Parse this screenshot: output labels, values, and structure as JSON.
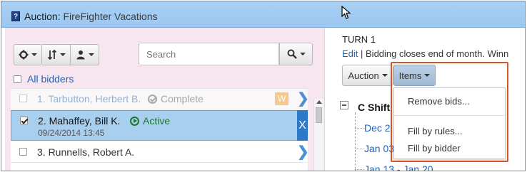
{
  "window": {
    "icon": "help-icon",
    "icon_glyph": "?",
    "title_prefix": "Auction:",
    "title_name": "FireFighter Vacations"
  },
  "toolbar": {
    "settings_icon": "gear-icon",
    "sort_icon": "sort-icon",
    "user_icon": "user-icon",
    "search_placeholder": "Search",
    "search_icon": "search-icon"
  },
  "bidders": {
    "all_label": "All bidders",
    "rows": [
      {
        "name": "1. Tarbutton, Herbert B.",
        "status": "Complete",
        "badge": "W",
        "checked": false
      },
      {
        "name": "2. Mahaffey, Bill K.",
        "status": "Active",
        "date": "09/24/2014 13:45",
        "checked": true,
        "remove_label": "X"
      },
      {
        "name": "3. Runnells, Robert A.",
        "checked": false
      }
    ]
  },
  "turn": {
    "title": "TURN 1",
    "edit_label": "Edit",
    "separator": " | ",
    "info_text": "Bidding closes end of month. Winn"
  },
  "actions": {
    "auction_label": "Auction",
    "items_label": "Items"
  },
  "items_menu": {
    "items": [
      "Remove bids...",
      "Fill by rules...",
      "Fill by bidder"
    ]
  },
  "tree": {
    "group": "C Shift",
    "entries": [
      "Dec 2",
      "Jan 03",
      "Jan 13 - Jan 20"
    ]
  },
  "colors": {
    "titlebar": "#a9d0f4",
    "active_row": "#a9cfee",
    "highlight": "#d9532b",
    "link": "#1c63b7",
    "active_status": "#1a7a2a"
  }
}
